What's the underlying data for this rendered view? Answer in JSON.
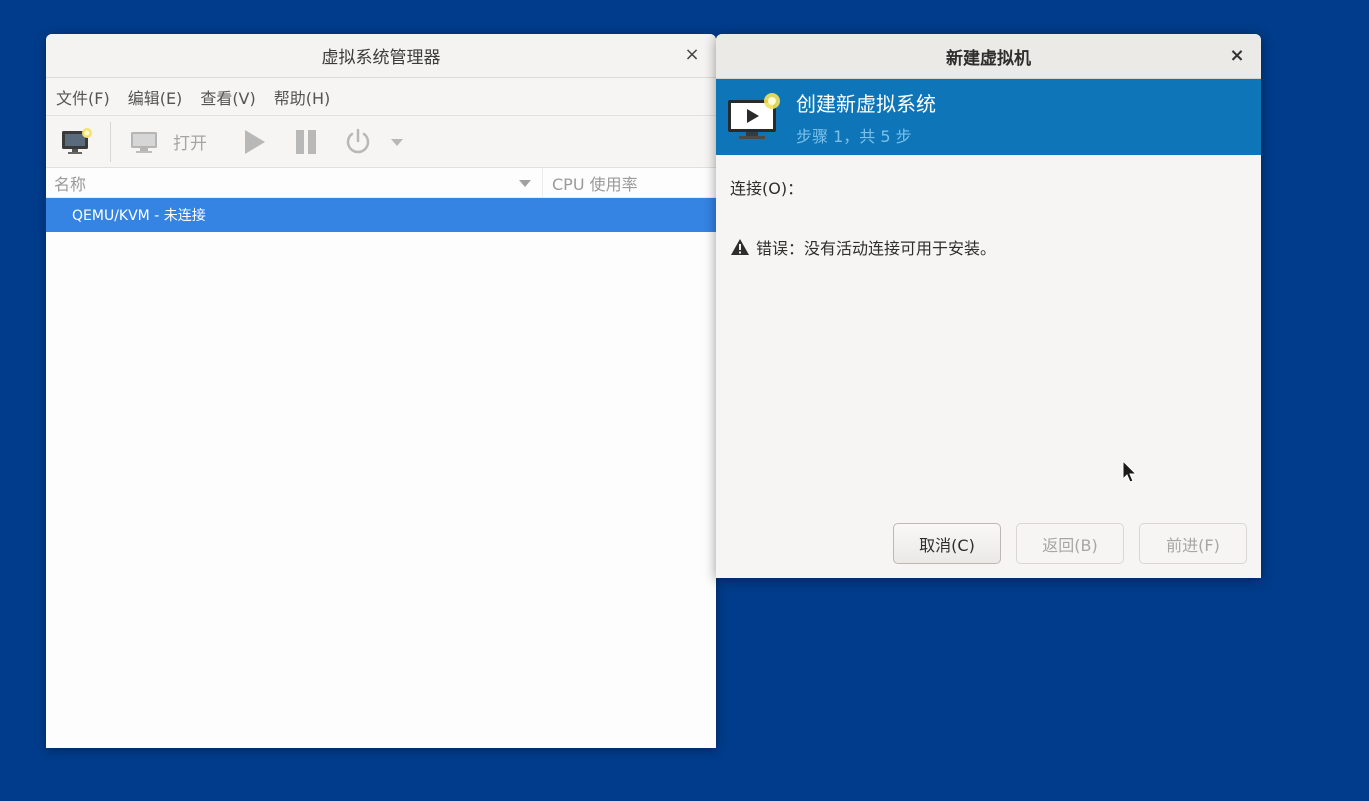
{
  "main_window": {
    "title": "虚拟系统管理器",
    "close": "×",
    "menu": [
      "文件(F)",
      "编辑(E)",
      "查看(V)",
      "帮助(H)"
    ],
    "toolbar": {
      "open_label": "打开"
    },
    "columns": {
      "name": "名称",
      "cpu": "CPU 使用率"
    },
    "rows": [
      {
        "label": "QEMU/KVM - 未连接",
        "selected": true
      }
    ]
  },
  "dialog": {
    "title": "新建虚拟机",
    "close": "×",
    "banner_title": "创建新虚拟系统",
    "banner_subtitle": "步骤 1，共 5 步",
    "connection_label": "连接(O)：",
    "error_text": "错误：没有活动连接可用于安装。",
    "buttons": {
      "cancel": "取消(C)",
      "back": "返回(B)",
      "forward": "前进(F)"
    }
  },
  "colors": {
    "desktop": "#003c8b",
    "selection": "#3584e4",
    "banner": "#0e75b8"
  }
}
